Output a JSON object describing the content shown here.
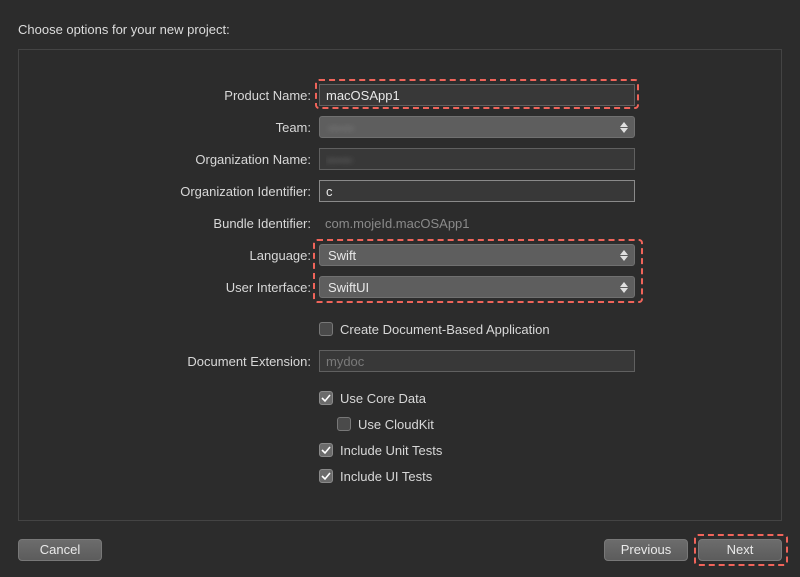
{
  "title": "Choose options for your new project:",
  "labels": {
    "productName": "Product Name:",
    "team": "Team:",
    "orgName": "Organization Name:",
    "orgId": "Organization Identifier:",
    "bundleId": "Bundle Identifier:",
    "language": "Language:",
    "userInterface": "User Interface:",
    "docExt": "Document Extension:"
  },
  "values": {
    "productName": "macOSApp1",
    "team": "——",
    "orgName": "——",
    "orgId": "c",
    "bundleId": "com.mojeId.macOSApp1",
    "language": "Swift",
    "userInterface": "SwiftUI",
    "docExtPlaceholder": "mydoc"
  },
  "checkboxes": {
    "createDoc": {
      "label": "Create Document-Based Application",
      "checked": false
    },
    "coreData": {
      "label": "Use Core Data",
      "checked": true
    },
    "cloudKit": {
      "label": "Use CloudKit",
      "checked": false
    },
    "unitTests": {
      "label": "Include Unit Tests",
      "checked": true
    },
    "uiTests": {
      "label": "Include UI Tests",
      "checked": true
    }
  },
  "buttons": {
    "cancel": "Cancel",
    "previous": "Previous",
    "next": "Next"
  },
  "colors": {
    "annotation": "#f0645a"
  }
}
